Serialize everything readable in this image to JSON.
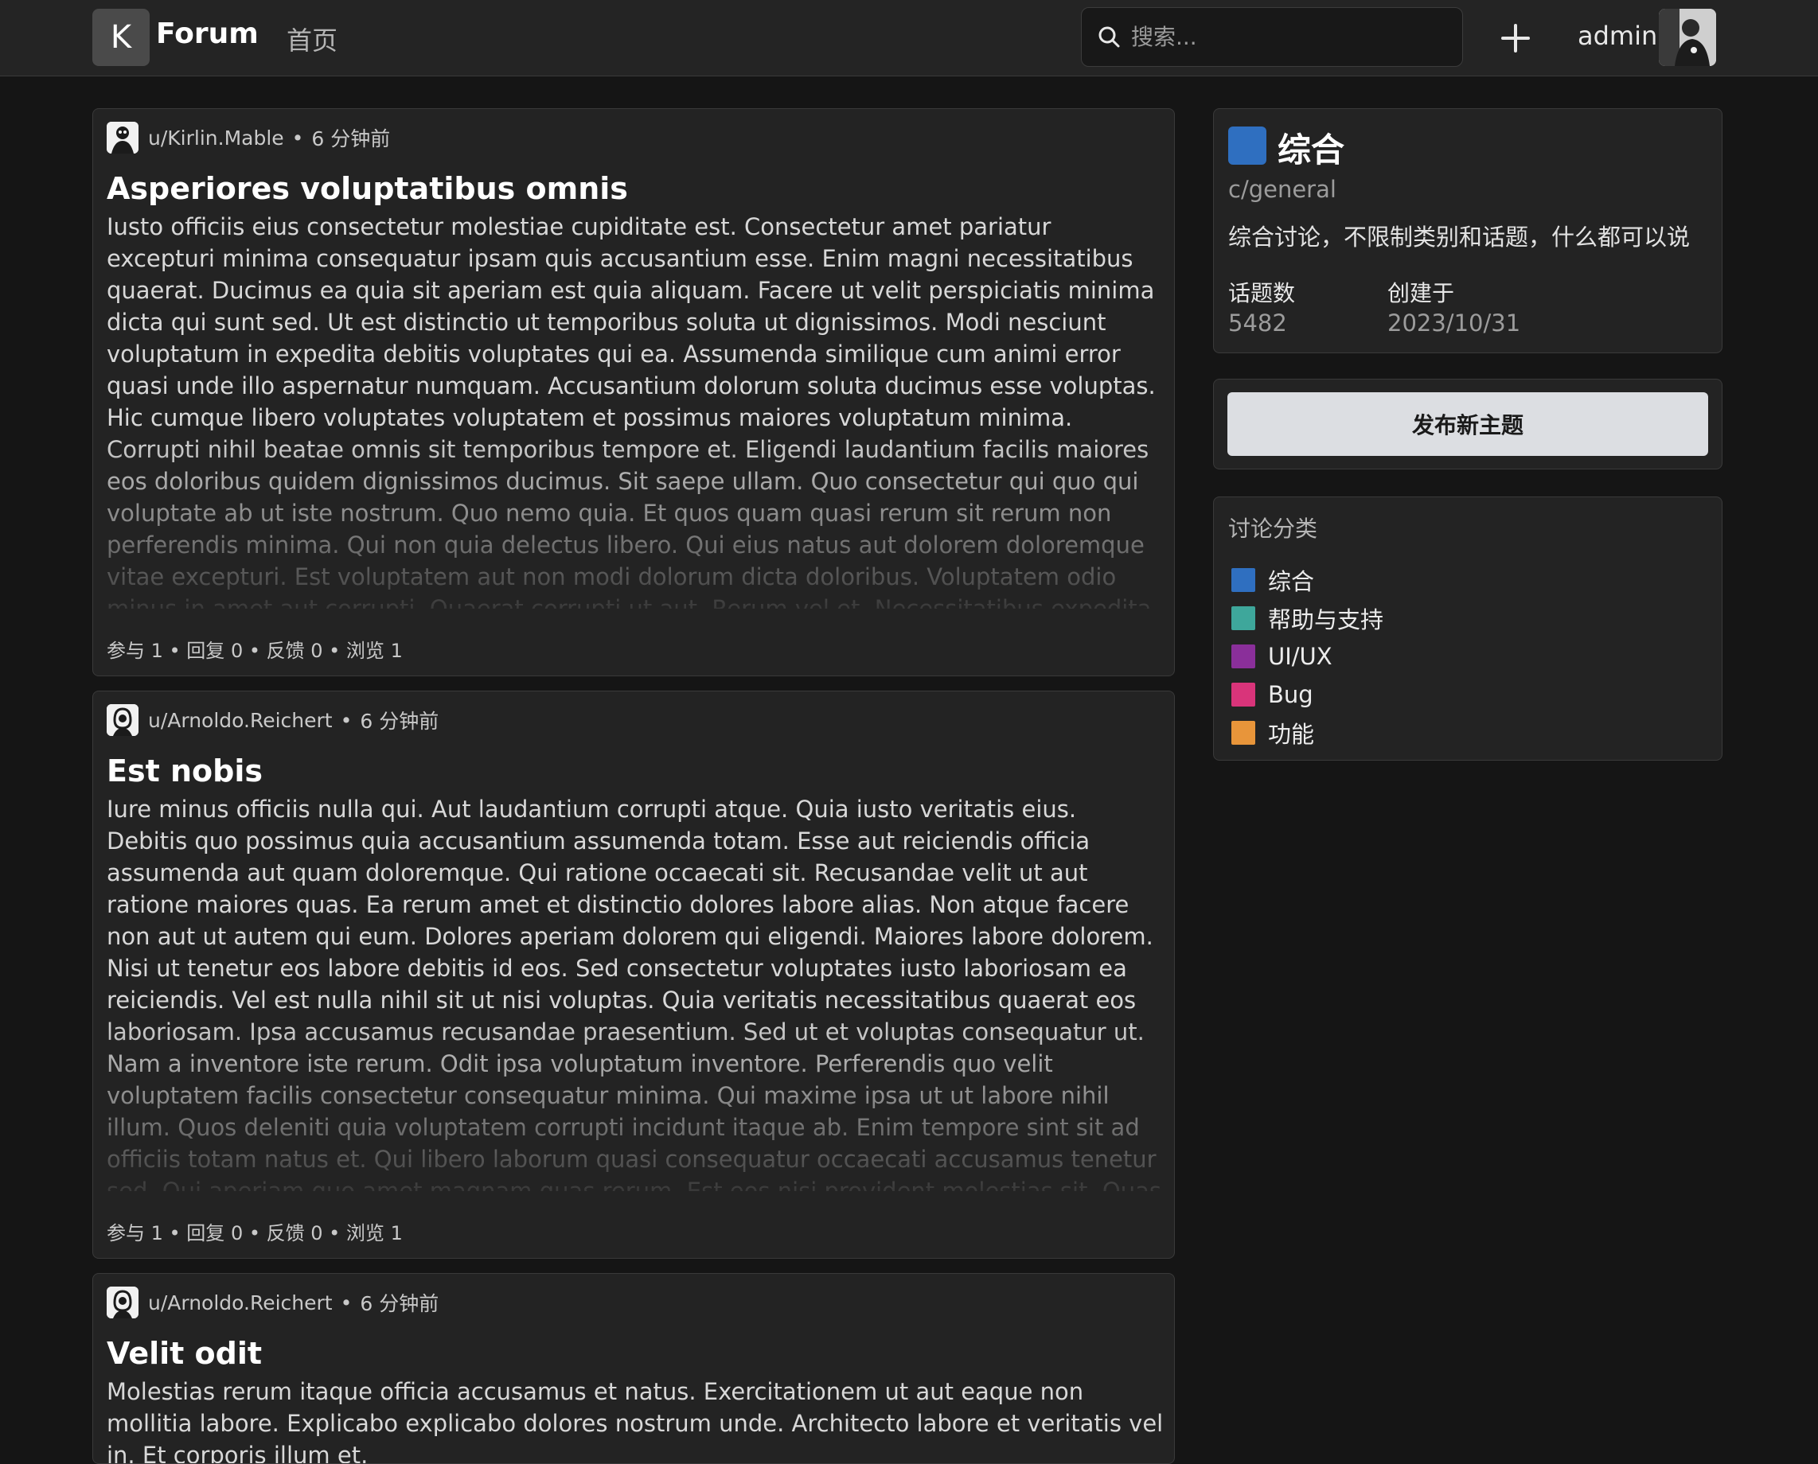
{
  "header": {
    "logo_letter": "K",
    "logo_text": "Forum",
    "nav_home": "首页",
    "search_placeholder": "搜索...",
    "user_name": "admin"
  },
  "posts": [
    {
      "author": "u/Kirlin.Mable",
      "time": "6 分钟前",
      "title": "Asperiores voluptatibus omnis",
      "body": "Iusto officiis eius consectetur molestiae cupiditate est. Consectetur amet pariatur excepturi minima consequatur ipsam quis accusantium esse. Enim magni necessitatibus quaerat. Ducimus ea quia sit aperiam est quia aliquam. Facere ut velit perspiciatis minima dicta qui sunt sed. Ut est distinctio ut temporibus soluta ut dignissimos. Modi nesciunt voluptatum in expedita debitis voluptates qui ea. Assumenda similique cum animi error quasi unde illo aspernatur numquam. Accusantium dolorum soluta ducimus esse voluptas. Hic cumque libero voluptates voluptatem et possimus maiores voluptatum minima. Corrupti nihil beatae omnis sit temporibus tempore et. Eligendi laudantium facilis maiores eos doloribus quidem dignissimos ducimus. Sit saepe ullam. Quo consectetur qui quo qui voluptate ab ut iste nostrum. Quo nemo quia. Et quos quam quasi rerum sit rerum non perferendis minima. Qui non quia delectus libero. Qui eius natus aut dolorem doloremque vitae excepturi. Est voluptatem aut non modi dolorum dicta doloribus. Voluptatem odio minus in amet aut corrupti. Quaerat corrupti ut aut. Rerum vel et. Necessitatibus expedita dicta labore sit ut non aut sed laudantium. A quasi iusto esse consectetur voluptates omnis ullam iusto. Dolor voluptatem error sunt",
      "stats": "参与 1 • 回复 0 • 反馈 0 • 浏览 1"
    },
    {
      "author": "u/Arnoldo.Reichert",
      "time": "6 分钟前",
      "title": "Est nobis",
      "body": "Iure minus officiis nulla qui. Aut laudantium corrupti atque. Quia iusto veritatis eius. Debitis quo possimus quia accusantium assumenda totam. Esse aut reiciendis officia assumenda aut quam doloremque. Qui ratione occaecati sit. Recusandae velit ut aut ratione maiores quas. Ea rerum amet et distinctio dolores labore alias. Non atque facere non aut ut autem qui eum. Dolores aperiam dolorem qui eligendi. Maiores labore dolorem. Nisi ut tenetur eos labore debitis id eos. Sed consectetur voluptates iusto laboriosam ea reiciendis. Vel est nulla nihil sit ut nisi voluptas. Quia veritatis necessitatibus quaerat eos laboriosam. Ipsa accusamus recusandae praesentium. Sed ut et voluptas consequatur ut. Nam a inventore iste rerum. Odit ipsa voluptatum inventore. Perferendis quo velit voluptatem facilis consectetur consequatur minima. Qui maxime ipsa ut ut labore nihil illum. Quos deleniti quia voluptatem corrupti incidunt itaque ab. Enim tempore sint sit ad officiis totam natus et. Qui libero laborum quasi consequatur occaecati accusamus tenetur sed. Qui aperiam quo amet magnam quas rerum. Est eos nisi provident molestias sit. Quas consectetur maiores est. Iure aut ullam dicta aut accusantium. Eveniet laudantium error aliquam illo. Numquam et corporis corrupti",
      "stats": "参与 1 • 回复 0 • 反馈 0 • 浏览 1"
    },
    {
      "author": "u/Arnoldo.Reichert",
      "time": "6 分钟前",
      "title": "Velit odit",
      "body": "Molestias rerum itaque officia accusamus et natus. Exercitationem ut aut eaque non mollitia labore. Explicabo explicabo dolores nostrum unde. Architecto labore et veritatis vel in. Et corporis illum et.",
      "stats": ""
    }
  ],
  "category": {
    "name": "综合",
    "slug": "c/general",
    "description": "综合讨论，不限制类别和话题，什么都可以说",
    "topics_label": "话题数",
    "topics_value": "5482",
    "created_label": "创建于",
    "created_value": "2023/10/31",
    "color": "#2f6fc0"
  },
  "new_topic_button": "发布新主题",
  "categories": {
    "heading": "讨论分类",
    "items": [
      {
        "name": "综合",
        "color": "#2f6fc0"
      },
      {
        "name": "帮助与支持",
        "color": "#3ea79b"
      },
      {
        "name": "UI/UX",
        "color": "#8a2f9a"
      },
      {
        "name": "Bug",
        "color": "#d9347a"
      },
      {
        "name": "功能",
        "color": "#e8953a"
      }
    ]
  }
}
